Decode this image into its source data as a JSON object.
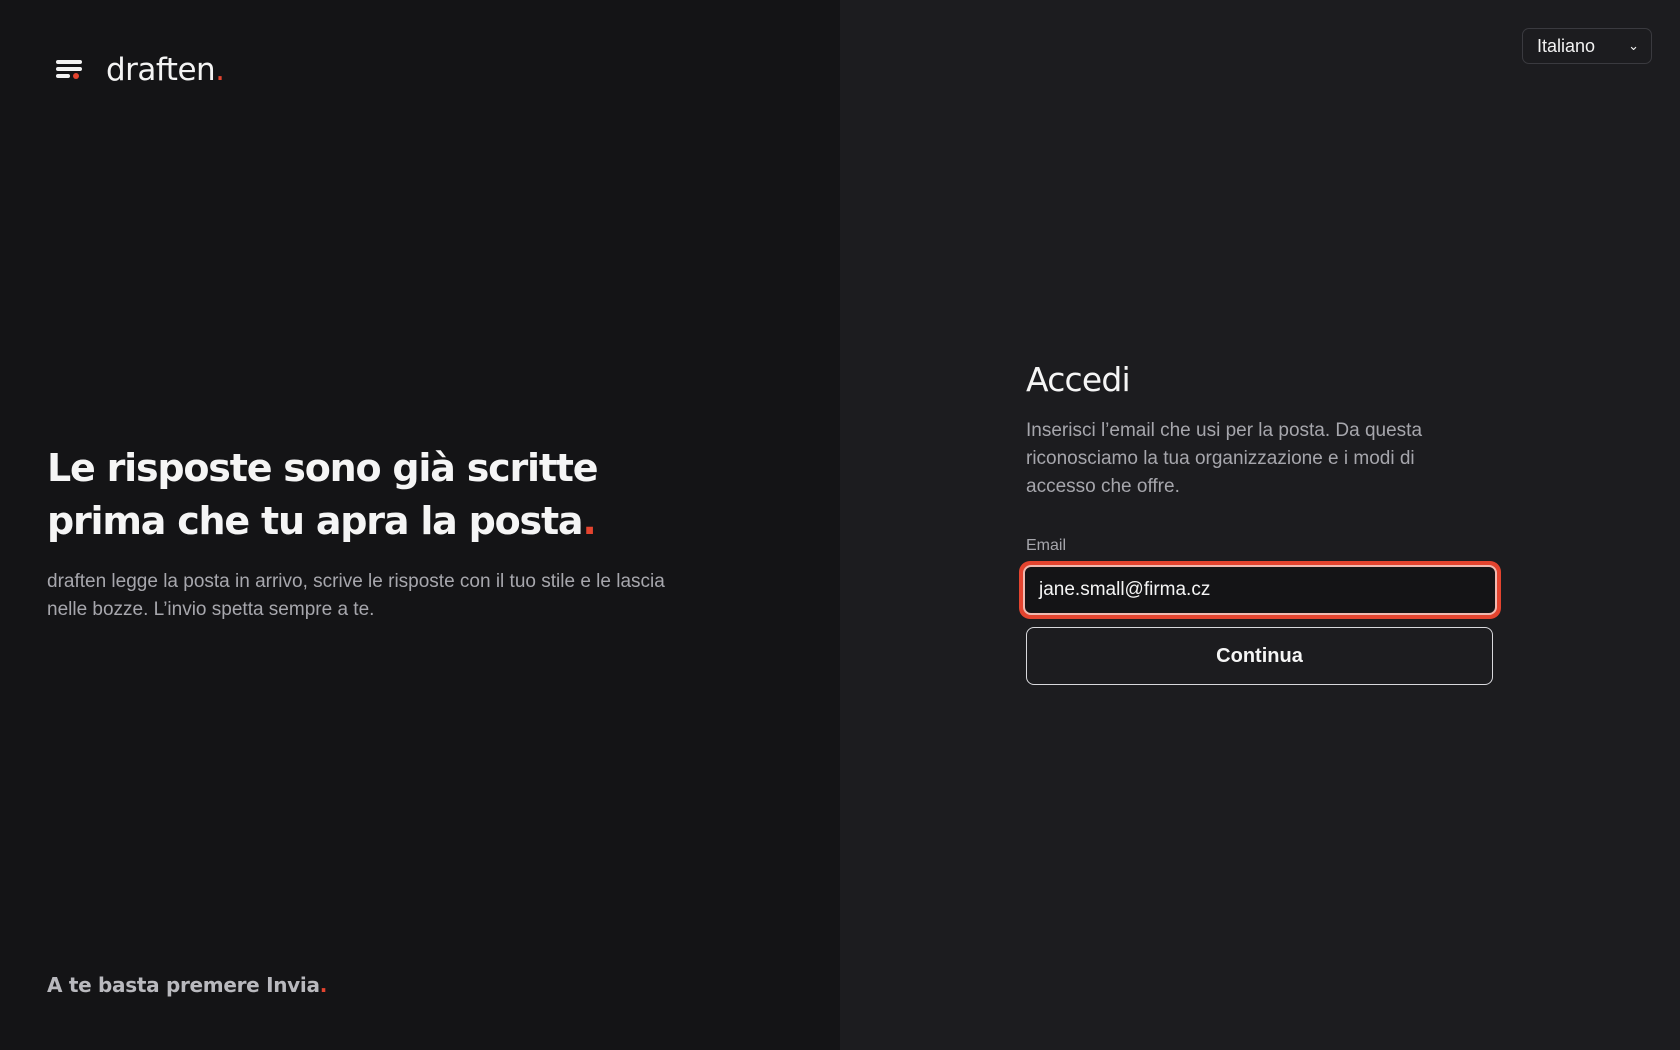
{
  "brand": {
    "name": "draften",
    "dot": "."
  },
  "hero": {
    "title": "Le risposte sono già scritte prima che tu apra la posta",
    "title_dot": ".",
    "subtitle": "draften legge la posta in arrivo, scrive le risposte con il tuo stile e le lascia nelle bozze. L’invio spetta sempre a te."
  },
  "footer": {
    "tagline": "A te basta premere Invia",
    "dot": "."
  },
  "language": {
    "selected": "Italiano"
  },
  "login": {
    "title": "Accedi",
    "description": "Inserisci l’email che usi per la posta. Da questa riconosciamo la tua organizzazione e i modi di accesso che offre.",
    "email_label": "Email",
    "email_value": "jane.small@firma.cz",
    "continue_label": "Continua"
  },
  "colors": {
    "accent": "#e4442f",
    "left_bg": "#141416",
    "right_bg": "#1c1c1f"
  }
}
